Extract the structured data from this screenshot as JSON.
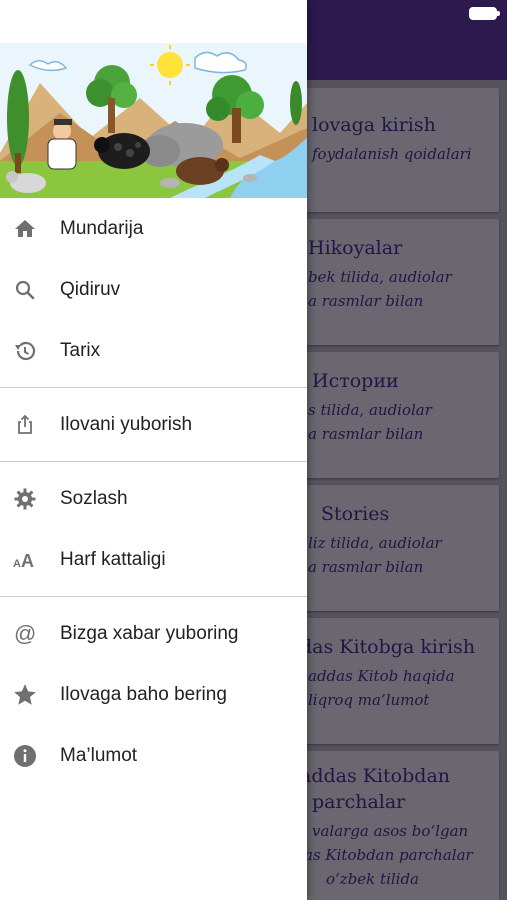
{
  "menu": {
    "home": "Mundarija",
    "search": "Qidiruv",
    "history": "Tarix",
    "share": "Ilovani yuborish",
    "settings": "Sozlash",
    "font_size": "Harf kattaligi",
    "contact": "Bizga xabar yuboring",
    "rate": "Ilovaga baho bering",
    "info": "Ma’lumot"
  },
  "cards": [
    {
      "title": "lovaga kirish",
      "lines": [
        "foydalanish qoidalari"
      ]
    },
    {
      "title": "Hikoyalar",
      "lines": [
        "bek tilida, audiolar",
        "a rasmlar bilan"
      ]
    },
    {
      "title": "Истории",
      "lines": [
        "s tilida, audiolar",
        "a rasmlar bilan"
      ]
    },
    {
      "title": "Stories",
      "lines": [
        "liz tilida, audiolar",
        "a rasmlar bilan"
      ]
    },
    {
      "title": "das Kitobga kirish",
      "lines": [
        "addas Kitob haqida",
        "liqroq ma’lumot"
      ]
    },
    {
      "title": "addas Kitobdan",
      "title2": "parchalar",
      "lines": [
        "valarga asos bo‘lgan",
        "as Kitobdan parchalar",
        "o‘zbek tilida"
      ]
    }
  ],
  "colors": {
    "header": "#2c1a4f",
    "card_text": "#1f1745",
    "drawer_bg": "#ffffff"
  },
  "icons": [
    "home-icon",
    "search-icon",
    "history-icon",
    "share-icon",
    "settings-icon",
    "font-size-icon",
    "at-icon",
    "star-icon",
    "info-icon"
  ]
}
